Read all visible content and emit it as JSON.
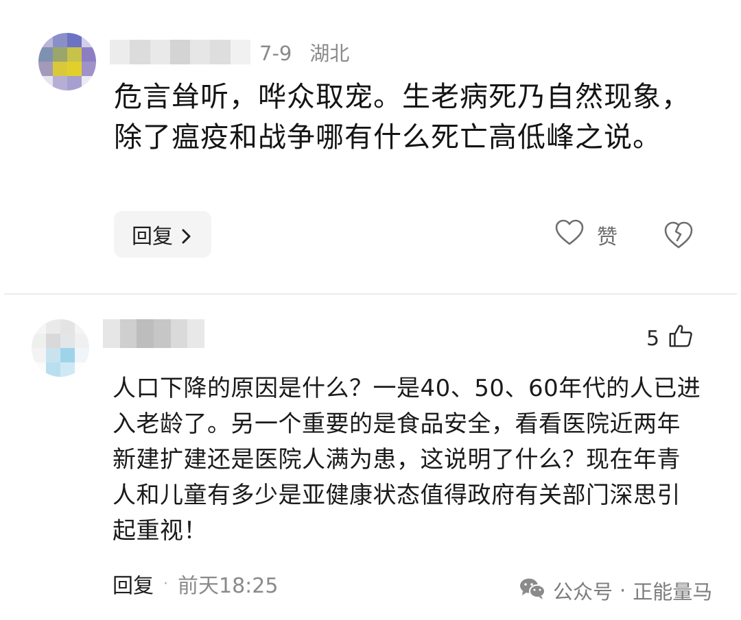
{
  "comments": [
    {
      "date": "7-9",
      "location": "湖北",
      "text": "危言耸听，哗众取宠。生老病死乃自然现象，除了瘟疫和战争哪有什么死亡高低峰之说。",
      "reply_label": "回复",
      "like_label": "赞",
      "icons": {
        "reply": "chevron-right-icon",
        "like": "heart-outline-icon",
        "dislike": "broken-heart-icon"
      }
    },
    {
      "like_count": "5",
      "text": "人口下降的原因是什么？一是40、50、60年代的人已进入老龄了。另一个重要的是食品安全，看看医院近两年新建扩建还是医院人满为患，这说明了什么？现在年青人和儿童有多少是亚健康状态值得政府有关部门深思引起重视！",
      "reply_label": "回复",
      "separator": "·",
      "time": "前天18:25",
      "icons": {
        "like": "thumbs-up-icon"
      }
    }
  ],
  "watermark": {
    "source": "公众号",
    "separator": "·",
    "account": "正能量马",
    "icon": "wechat-icon"
  },
  "colors": {
    "meta_gray": "#8a8a8a",
    "reply_button_bg": "#f4f4f4",
    "divider": "#ececec"
  }
}
